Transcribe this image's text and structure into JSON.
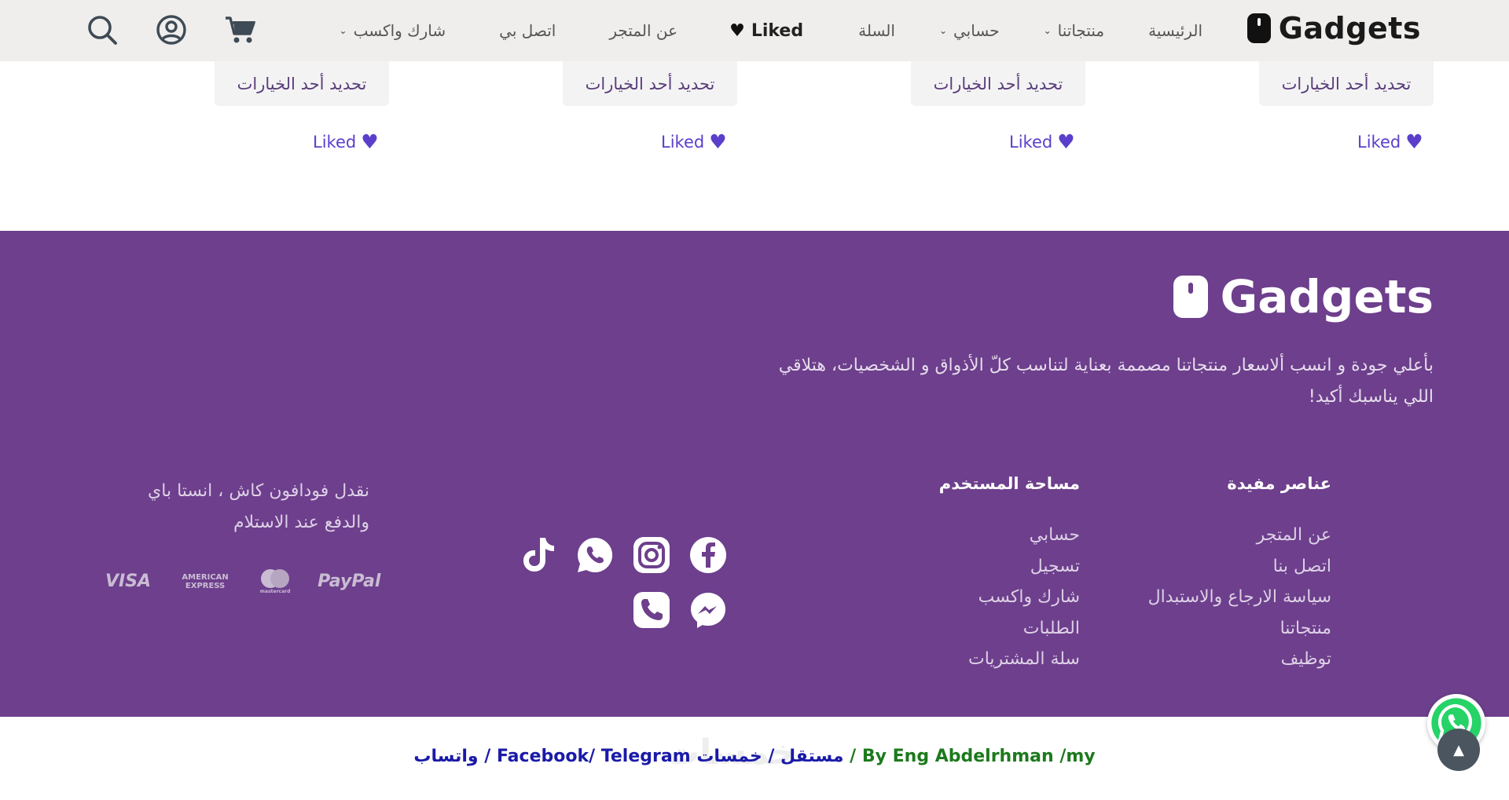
{
  "header": {
    "logo_text": "Gadgets",
    "nav": [
      {
        "label": "الرئيسية",
        "dropdown": false
      },
      {
        "label": "منتجاتنا",
        "dropdown": true
      },
      {
        "label": "حسابي",
        "dropdown": true
      },
      {
        "label": "السلة",
        "dropdown": false
      },
      {
        "label": "Liked",
        "dropdown": false
      },
      {
        "label": "عن المتجر",
        "dropdown": false
      },
      {
        "label": "اتصل بي",
        "dropdown": false
      },
      {
        "label": "شارك واكسب",
        "dropdown": true
      }
    ],
    "icons": [
      "search-icon",
      "account-icon",
      "cart-icon"
    ]
  },
  "products": {
    "option_label": "تحديد أحد الخيارات",
    "liked_label": "Liked",
    "count": 4
  },
  "footer": {
    "logo_text": "Gadgets",
    "description": "بأعلي جودة و انسب ألاسعار منتجاتنا مصممة بعناية لتناسب كلّ الأذواق و الشخصيات، هتلاقي اللي يناسبك أكيد!",
    "useful": {
      "title": "عناصر مفيدة",
      "links": [
        "عن المتجر",
        "اتصل بنا",
        "سياسة الارجاع والاستبدال",
        "منتجاتنا",
        "توظيف"
      ]
    },
    "user_area": {
      "title": "مساحة المستخدم",
      "links": [
        "حسابي",
        "تسجيل",
        "شارك واكسب",
        "الطلبات",
        "سلة المشتريات"
      ]
    },
    "social_icons": [
      "facebook-icon",
      "instagram-icon",
      "whatsapp-icon",
      "tiktok-icon",
      "messenger-icon",
      "phone-icon"
    ],
    "payment_text": "نقدل فودافون كاش ، انستا باي والدفع عند الاستلام",
    "payment_logos": [
      "PayPal",
      "mastercard",
      "AMERICAN EXPRESS",
      "VISA"
    ]
  },
  "bottom": {
    "credit_prefix": "/my ",
    "credit_author": "By Eng Abdelrhman",
    "sep": " / ",
    "link_khamsat": "خمسات",
    "link_mostaql": "مستقل",
    "link_telegram": "Telegram",
    "link_facebook": "Facebook",
    "link_whatsapp": "واتساب",
    "watermark": "خمسات"
  },
  "colors": {
    "footer_bg": "#6d3f8c",
    "header_bg": "#efeeec",
    "liked_purple": "#5b3fcb"
  }
}
